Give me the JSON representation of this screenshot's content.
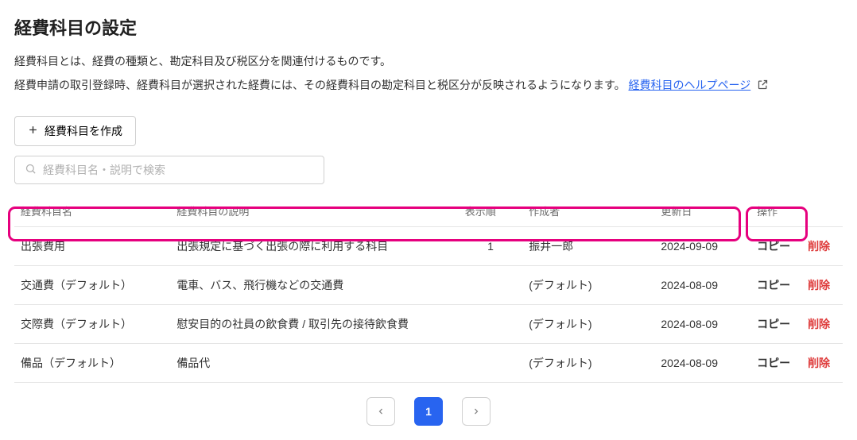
{
  "page": {
    "title": "経費科目の設定",
    "desc1": "経費科目とは、経費の種類と、勘定科目及び税区分を関連付けるものです。",
    "desc2_a": "経費申請の取引登録時、経費科目が選択された経費には、その経費科目の勘定科目と税区分が反映されるようになります。",
    "help_link": "経費科目のヘルプページ"
  },
  "buttons": {
    "create": "経費科目を作成",
    "copy": "コピー",
    "delete": "削除"
  },
  "search": {
    "placeholder": "経費科目名・説明で検索"
  },
  "columns": {
    "name": "経費科目名",
    "desc": "経費科目の説明",
    "order": "表示順",
    "author": "作成者",
    "date": "更新日",
    "ops": "操作"
  },
  "rows": [
    {
      "name": "出張費用",
      "desc": "出張規定に基づく出張の際に利用する科目",
      "order": "1",
      "author": "振井一郎",
      "date": "2024-09-09"
    },
    {
      "name": "交通費（デフォルト）",
      "desc": "電車、バス、飛行機などの交通費",
      "order": "",
      "author": "(デフォルト)",
      "date": "2024-08-09"
    },
    {
      "name": "交際費（デフォルト）",
      "desc": "慰安目的の社員の飲食費 / 取引先の接待飲食費",
      "order": "",
      "author": "(デフォルト)",
      "date": "2024-08-09"
    },
    {
      "name": "備品（デフォルト）",
      "desc": "備品代",
      "order": "",
      "author": "(デフォルト)",
      "date": "2024-08-09"
    }
  ],
  "pagination": {
    "current": "1"
  }
}
